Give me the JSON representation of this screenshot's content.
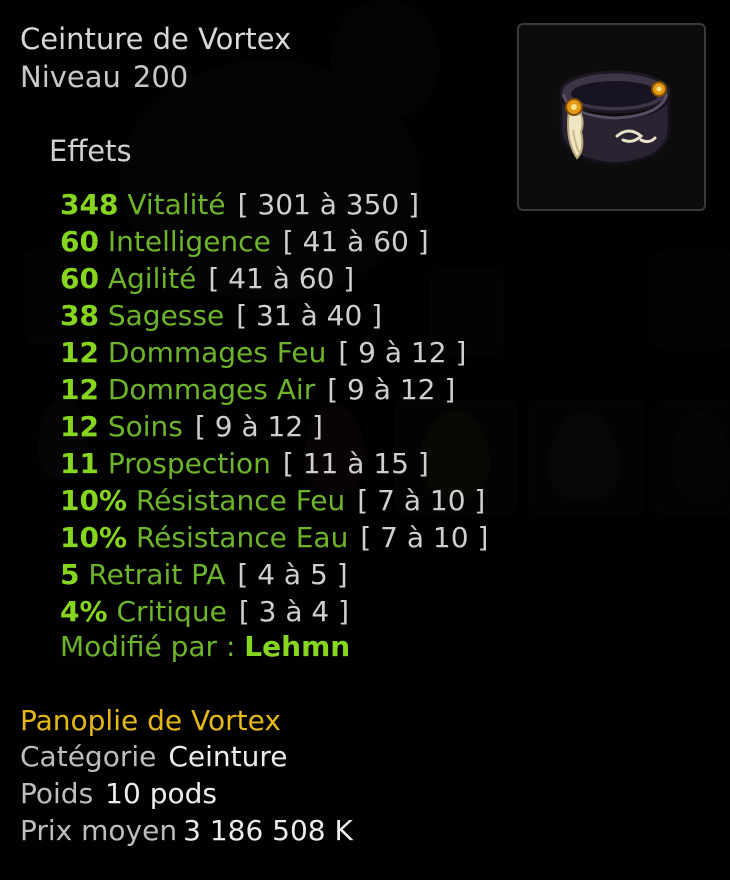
{
  "item": {
    "name": "Ceinture de Vortex",
    "level_label": "Niveau",
    "level_value": "200",
    "image_icon": "belt-icon"
  },
  "effects_title": "Effets",
  "effects": [
    {
      "value": "348",
      "name": "Vitalité",
      "range": "[ 301 à 350 ]"
    },
    {
      "value": "60",
      "name": "Intelligence",
      "range": "[ 41 à 60 ]"
    },
    {
      "value": "60",
      "name": "Agilité",
      "range": "[ 41 à 60 ]"
    },
    {
      "value": "38",
      "name": "Sagesse",
      "range": "[ 31 à 40 ]"
    },
    {
      "value": "12",
      "name": "Dommages Feu",
      "range": "[ 9 à 12 ]"
    },
    {
      "value": "12",
      "name": "Dommages Air",
      "range": "[ 9 à 12 ]"
    },
    {
      "value": "12",
      "name": "Soins",
      "range": "[ 9 à 12 ]"
    },
    {
      "value": "11",
      "name": "Prospection",
      "range": "[ 11 à 15 ]"
    },
    {
      "value": "10%",
      "name": "Résistance Feu",
      "range": "[ 7 à 10 ]"
    },
    {
      "value": "10%",
      "name": "Résistance Eau",
      "range": "[ 7 à 10 ]"
    },
    {
      "value": "5",
      "name": "Retrait PA",
      "range": "[ 4 à 5 ]"
    },
    {
      "value": "4%",
      "name": "Critique",
      "range": "[ 3 à 4 ]"
    }
  ],
  "modified": {
    "label": "Modifié par :",
    "author": "Lehmn"
  },
  "set_name": "Panoplie de Vortex",
  "category": {
    "label": "Catégorie",
    "value": "Ceinture"
  },
  "weight": {
    "label": "Poids",
    "value": "10 pods"
  },
  "price": {
    "label": "Prix moyen",
    "value": "3 186 508 K"
  },
  "colors": {
    "effect_value": "#86d61f",
    "effect_name": "#6db42a",
    "set_name": "#e5b81a",
    "range": "#cfcfcf"
  }
}
